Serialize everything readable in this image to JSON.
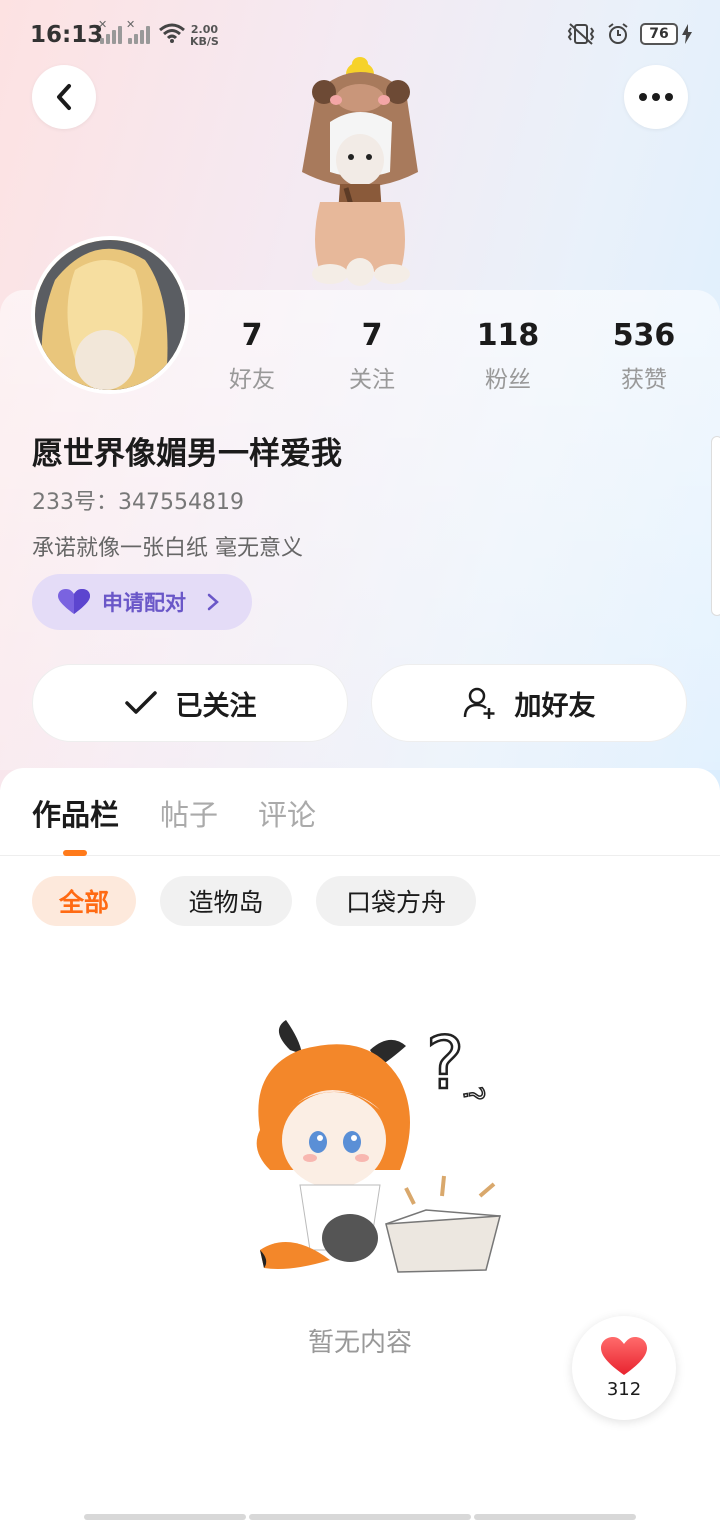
{
  "status_bar": {
    "time": "16:13",
    "net_speed_value": "2.00",
    "net_speed_unit": "KB/S",
    "battery": "76"
  },
  "header": {
    "back_icon": "chevron-left-icon",
    "more_icon": "more-dots-icon"
  },
  "profile": {
    "stats": [
      {
        "value": "7",
        "label": "好友"
      },
      {
        "value": "7",
        "label": "关注"
      },
      {
        "value": "118",
        "label": "粉丝"
      },
      {
        "value": "536",
        "label": "获赞"
      }
    ],
    "nickname": "愿世界像媚男一样爱我",
    "uid": "233号：347554819",
    "bio": "承诺就像一张白纸 毫无意义",
    "match_label": "申请配对"
  },
  "actions": {
    "follow_label": "已关注",
    "add_friend_label": "加好友"
  },
  "tabs": [
    {
      "label": "作品栏",
      "active": true
    },
    {
      "label": "帖子",
      "active": false
    },
    {
      "label": "评论",
      "active": false
    }
  ],
  "filters": [
    {
      "label": "全部",
      "active": true
    },
    {
      "label": "造物岛",
      "active": false
    },
    {
      "label": "口袋方舟",
      "active": false
    }
  ],
  "empty_state": {
    "text": "暂无内容"
  },
  "like_fab": {
    "count": "312"
  },
  "colors": {
    "accent": "#ff7a1a",
    "match_purple": "#6a57c8"
  }
}
